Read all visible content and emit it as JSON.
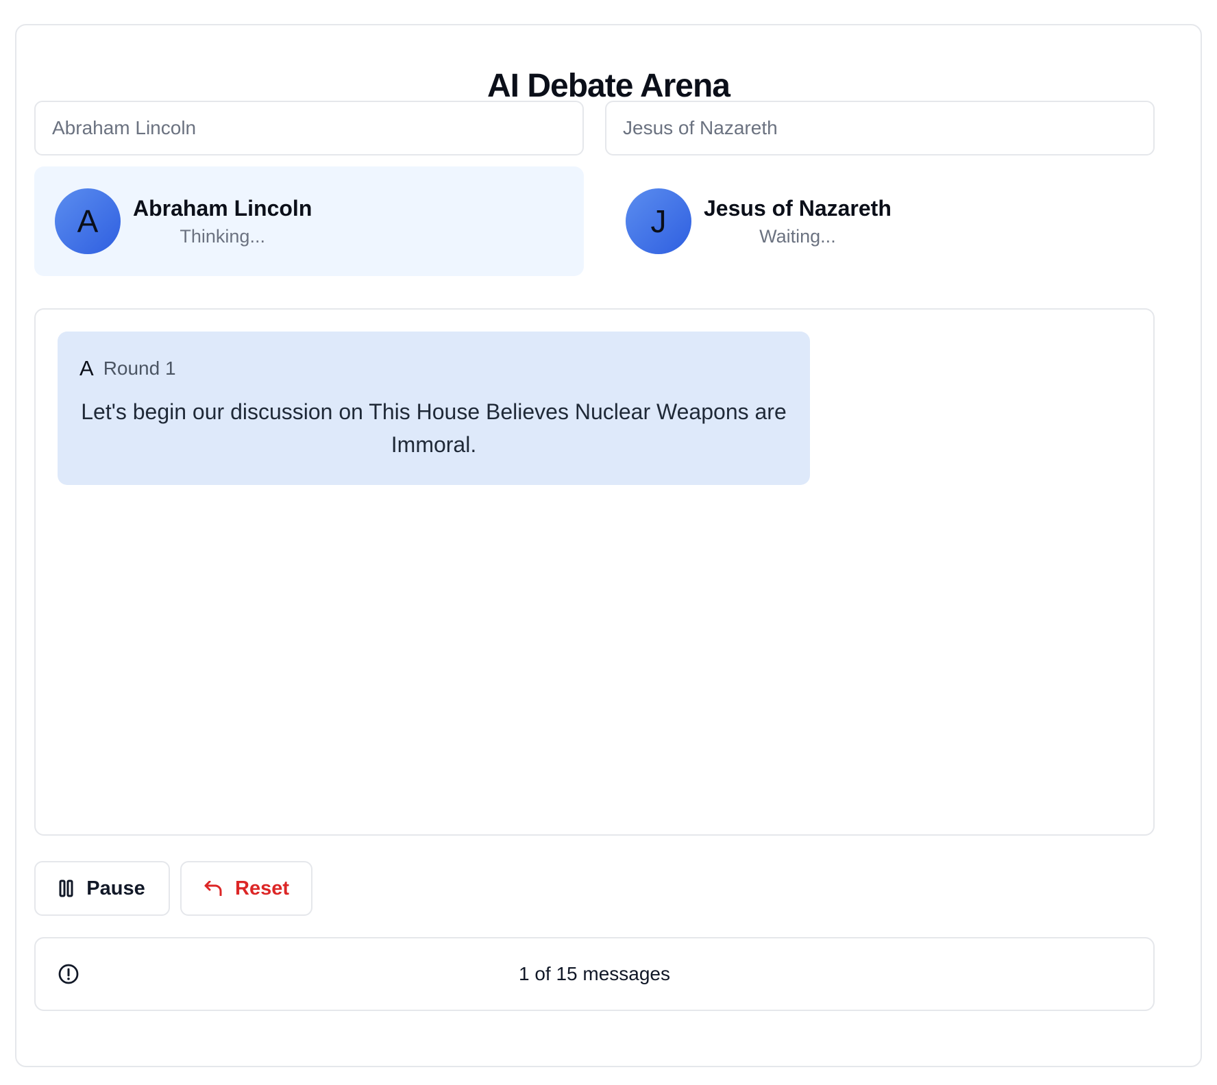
{
  "app": {
    "title": "AI Debate Arena"
  },
  "inputs": {
    "left_placeholder": "Abraham Lincoln",
    "right_placeholder": "Jesus of Nazareth"
  },
  "debaters": [
    {
      "initial": "A",
      "name": "Abraham Lincoln",
      "status": "Thinking...",
      "active": true
    },
    {
      "initial": "J",
      "name": "Jesus of Nazareth",
      "status": "Waiting...",
      "active": false
    }
  ],
  "messages": [
    {
      "initial": "A",
      "round": "Round 1",
      "text": "Let's begin our discussion on This House Believes Nuclear Weapons are Immoral."
    }
  ],
  "controls": {
    "pause_label": "Pause",
    "pause_icon": "pause-icon",
    "reset_label": "Reset",
    "reset_icon": "undo-icon"
  },
  "status": {
    "icon": "alert-circle-icon",
    "text": "1 of 15 messages"
  },
  "colors": {
    "accent": "#2f5fe0",
    "active_panel": "#eff6ff",
    "message_bg": "#dee9fa",
    "reset_red": "#dc2626",
    "border": "#e5e7eb"
  }
}
